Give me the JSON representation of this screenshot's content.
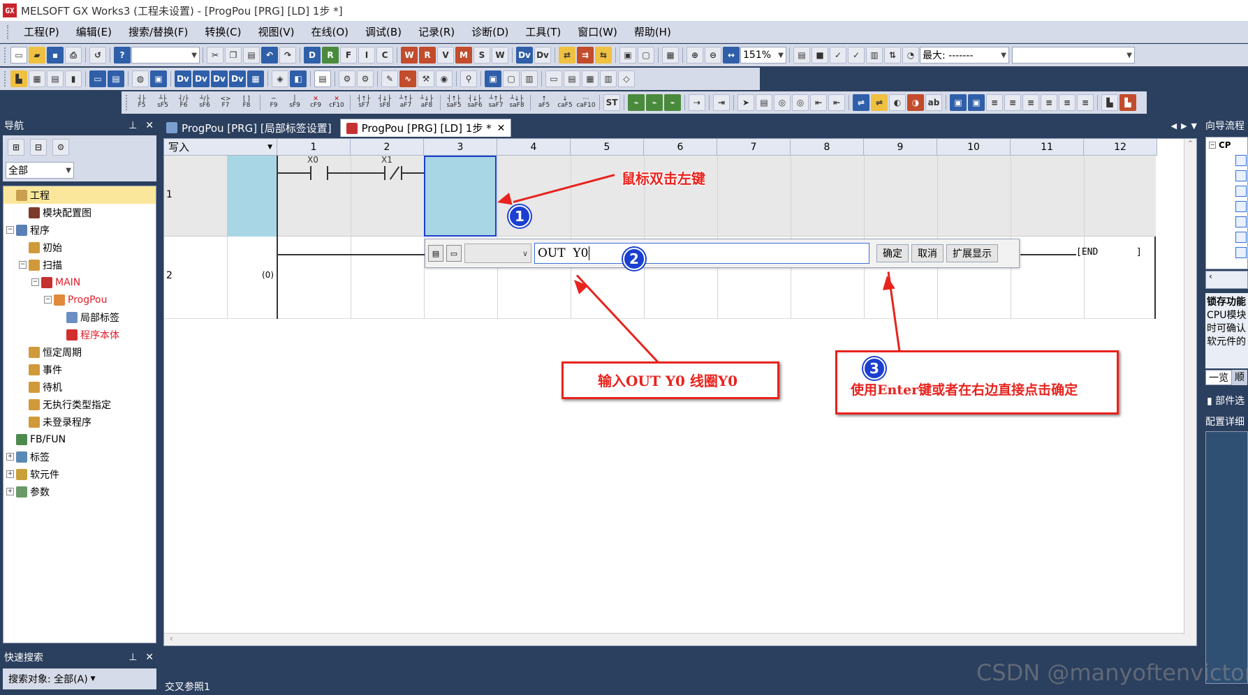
{
  "window": {
    "title": "MELSOFT GX Works3 (工程未设置) - [ProgPou [PRG] [LD] 1步 *]",
    "app_icon": "GX"
  },
  "menu": [
    "工程(P)",
    "编辑(E)",
    "搜索/替换(F)",
    "转换(C)",
    "视图(V)",
    "在线(O)",
    "调试(B)",
    "记录(R)",
    "诊断(D)",
    "工具(T)",
    "窗口(W)",
    "帮助(H)"
  ],
  "toolbar": {
    "zoom": "151%",
    "max_label": "最大: -------"
  },
  "fkeys": [
    [
      "F5"
    ],
    [
      "sF5"
    ],
    [
      "F6"
    ],
    [
      "sF6"
    ],
    [
      "F7"
    ],
    [
      "F8"
    ],
    [
      "F9"
    ],
    [
      "sF9"
    ],
    [
      "cF9"
    ],
    [
      "cF10"
    ],
    [
      "sF7"
    ],
    [
      "sF8"
    ],
    [
      "aF7"
    ],
    [
      "aF8"
    ],
    [
      "saF5"
    ],
    [
      "saF6"
    ],
    [
      "saF7"
    ],
    [
      "saF8"
    ],
    [
      "aF5"
    ],
    [
      "caF5"
    ],
    [
      "caF10"
    ]
  ],
  "nav": {
    "title": "导航",
    "filter": "全部",
    "tree": [
      {
        "label": "工程",
        "level": 0,
        "icon": "project-icon",
        "exp": "",
        "selected": true
      },
      {
        "label": "模块配置图",
        "level": 1,
        "icon": "module-config-icon",
        "exp": ""
      },
      {
        "label": "程序",
        "level": 0,
        "icon": "program-folder-icon",
        "exp": "−"
      },
      {
        "label": "初始",
        "level": 1,
        "icon": "init-folder-icon",
        "exp": ""
      },
      {
        "label": "扫描",
        "level": 1,
        "icon": "scan-folder-icon",
        "exp": "−"
      },
      {
        "label": "MAIN",
        "level": 2,
        "icon": "main-program-icon",
        "exp": "−",
        "red": true
      },
      {
        "label": "ProgPou",
        "level": 3,
        "icon": "pou-icon",
        "exp": "−",
        "red": true
      },
      {
        "label": "局部标签",
        "level": 4,
        "icon": "local-label-icon",
        "exp": ""
      },
      {
        "label": "程序本体",
        "level": 4,
        "icon": "program-body-icon",
        "exp": "",
        "red": true
      },
      {
        "label": "恒定周期",
        "level": 1,
        "icon": "fixed-scan-icon",
        "exp": ""
      },
      {
        "label": "事件",
        "level": 1,
        "icon": "event-icon",
        "exp": ""
      },
      {
        "label": "待机",
        "level": 1,
        "icon": "standby-icon",
        "exp": ""
      },
      {
        "label": "无执行类型指定",
        "level": 1,
        "icon": "no-exec-icon",
        "exp": ""
      },
      {
        "label": "未登录程序",
        "level": 1,
        "icon": "unregistered-icon",
        "exp": ""
      },
      {
        "label": "FB/FUN",
        "level": 0,
        "icon": "fb-fun-icon",
        "exp": ""
      },
      {
        "label": "标签",
        "level": 0,
        "icon": "label-icon",
        "exp": "+"
      },
      {
        "label": "软元件",
        "level": 0,
        "icon": "device-icon",
        "exp": "+"
      },
      {
        "label": "参数",
        "level": 0,
        "icon": "parameter-icon",
        "exp": "+"
      }
    ]
  },
  "quick_search": {
    "title": "快速搜索",
    "target": "搜索对象: 全部(A)"
  },
  "tabs": [
    {
      "label": "ProgPou [PRG] [局部标签设置]",
      "active": false
    },
    {
      "label": "ProgPou [PRG] [LD] 1步 *",
      "active": true
    }
  ],
  "editor": {
    "mode": "写入",
    "columns": [
      "1",
      "2",
      "3",
      "4",
      "5",
      "6",
      "7",
      "8",
      "9",
      "10",
      "11",
      "12"
    ],
    "row1": {
      "number": "1",
      "contacts": [
        "X0",
        "X1"
      ]
    },
    "row2": {
      "number": "2",
      "step": "(0)",
      "end": "END"
    },
    "input_value": "OUT  Y0",
    "ok": "确定",
    "cancel": "取消",
    "expand": "扩展显示"
  },
  "right_panel": {
    "title": "向导流程",
    "cpu": "CP",
    "lock_title": "锁存功能",
    "lock_lines": [
      "CPU模块",
      "时可确认",
      "软元件的"
    ],
    "tab1": "一览",
    "tab2": "顺",
    "parts": "部件选",
    "config": "配置详细"
  },
  "xref": "交叉参照1",
  "annotations": {
    "a1": "鼠标双击左键",
    "a2": "输入OUT Y0    线圈Y0",
    "a3": "使用Enter键或者在右边直接点击确定",
    "n1": "1",
    "n2": "2",
    "n3": "3"
  },
  "watermark": "CSDN @manyoftenvictory",
  "colors": {
    "accent": "#1b3fd0",
    "annotation": "#e8231e",
    "frame": "#2b3f5e",
    "selection": "#a9d6e5"
  }
}
